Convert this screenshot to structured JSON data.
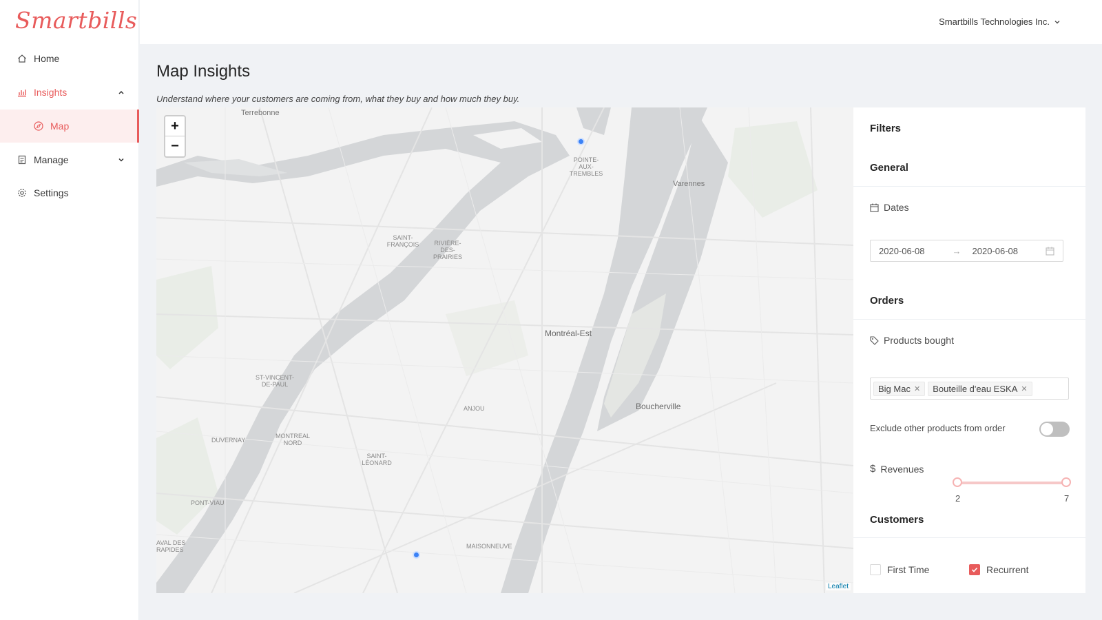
{
  "brand": {
    "logo_text": "Smartbills",
    "accent": "#e85b5b"
  },
  "sidebar": {
    "items": [
      {
        "label": "Home",
        "icon": "home-icon"
      },
      {
        "label": "Insights",
        "icon": "bar-chart-icon",
        "expanded": true
      },
      {
        "label": "Map",
        "icon": "compass-icon",
        "selected": true
      },
      {
        "label": "Manage",
        "icon": "clipboard-icon",
        "expanded": false
      },
      {
        "label": "Settings",
        "icon": "gear-icon"
      }
    ]
  },
  "header": {
    "company": "Smartbills Technologies Inc."
  },
  "page": {
    "title": "Map Insights",
    "subtitle": "Understand where your customers are coming from, what they buy and how much they buy."
  },
  "map": {
    "zoom_in": "+",
    "zoom_out": "−",
    "attribution": "Leaflet",
    "labels": {
      "terrebonne": "Terrebonne",
      "pointe": "POINTE-AUX-TREMBLES",
      "varennes": "Varennes",
      "saint_francois": "SAINT-FRANÇOIS",
      "riviere": "RIVIÈRE-DES-PRAIRIES",
      "montreal_est": "Montréal-Est",
      "st_vincent": "ST-VINCENT-DE-PAUL",
      "anjou": "ANJOU",
      "boucherville": "Boucherville",
      "duvernay": "DUVERNAY",
      "montreal_nord": "MONTREAL NORD",
      "saint_leonard": "SAINT-LÉONARD",
      "pont_viau": "PONT-VIAU",
      "maisonneuve": "MAISONNEUVE",
      "aval": "AVAL DES RAPIDES"
    }
  },
  "filters": {
    "title": "Filters",
    "general": {
      "title": "General",
      "dates_label": "Dates",
      "date_start": "2020-06-08",
      "date_end": "2020-06-08"
    },
    "orders": {
      "title": "Orders",
      "products_label": "Products bought",
      "products": [
        "Big Mac",
        "Bouteille d'eau ESKA"
      ],
      "exclude_label": "Exclude other products from order",
      "exclude_on": false,
      "revenues_label": "Revenues",
      "revenue_min": "2",
      "revenue_max": "7"
    },
    "customers": {
      "title": "Customers",
      "first_time_label": "First Time",
      "first_time_checked": false,
      "recurrent_label": "Recurrent",
      "recurrent_checked": true
    }
  }
}
